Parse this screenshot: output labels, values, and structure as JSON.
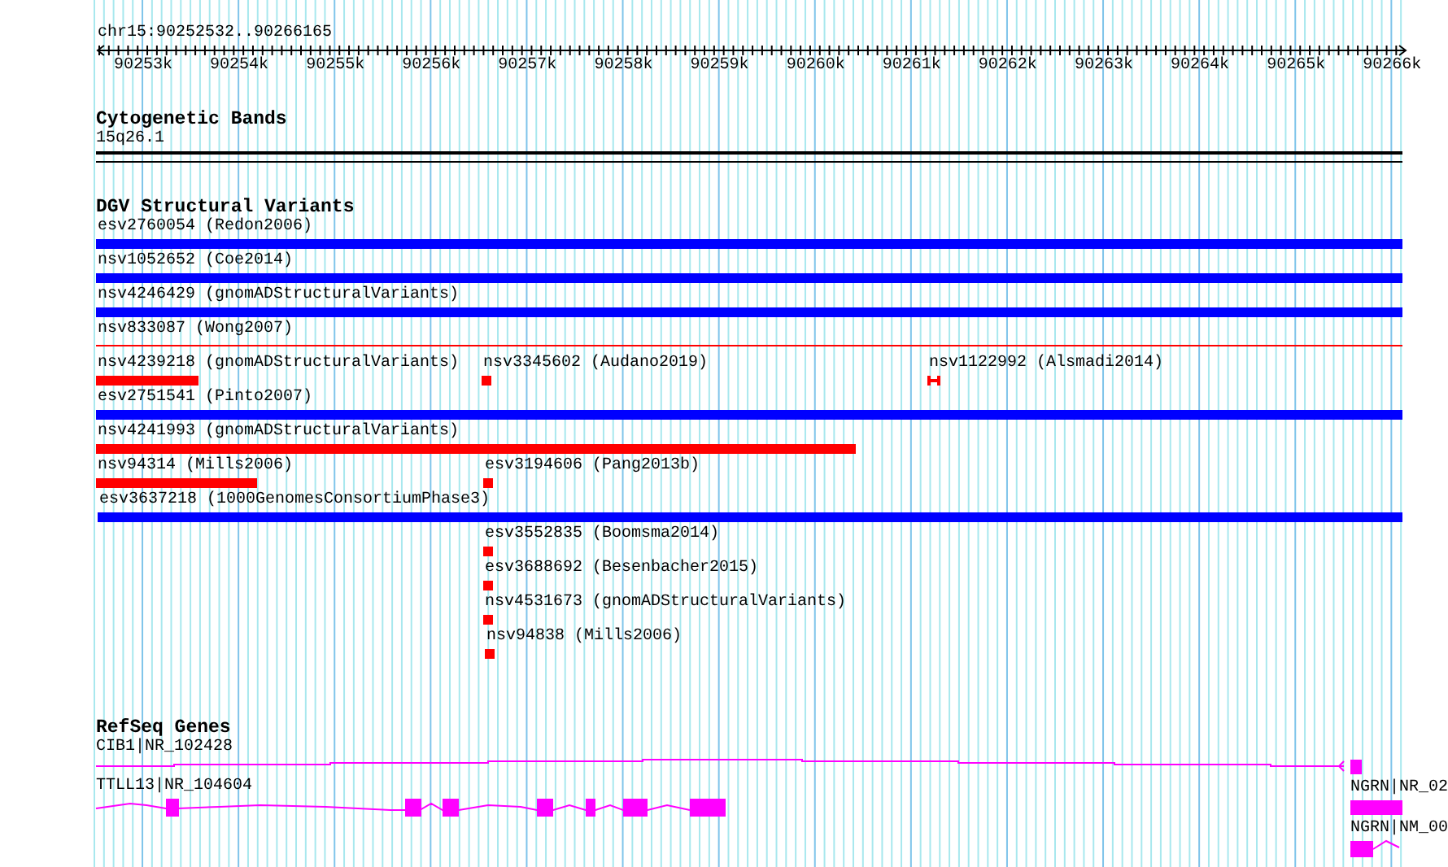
{
  "ruler": {
    "location": "chr15:90252532..90266165",
    "ticks": [
      "90253k",
      "90254k",
      "90255k",
      "90256k",
      "90257k",
      "90258k",
      "90259k",
      "90260k",
      "90261k",
      "90262k",
      "90263k",
      "90264k",
      "90265k",
      "90266k"
    ]
  },
  "cytobands": {
    "title": "Cytogenetic Bands",
    "band": "15q26.1"
  },
  "variants": {
    "title": "DGV Structural Variants",
    "features": [
      {
        "label": "esv2760054 (Redon2006)",
        "color": "#0000ff",
        "kind": "bar"
      },
      {
        "label": "nsv1052652 (Coe2014)",
        "color": "#0000ff",
        "kind": "bar"
      },
      {
        "label": "nsv4246429 (gnomADStructuralVariants)",
        "color": "#0000ff",
        "kind": "bar"
      },
      {
        "label": "nsv833087 (Wong2007)",
        "color": "#ff0000",
        "kind": "line"
      },
      {
        "label": "nsv4239218 (gnomADStructuralVariants)",
        "color": "#ff0000",
        "kind": "bar"
      },
      {
        "label": "nsv3345602 (Audano2019)",
        "color": "#ff0000",
        "kind": "bar"
      },
      {
        "label": "nsv1122992 (Alsmadi2014)",
        "color": "#ff0000",
        "kind": "marker"
      },
      {
        "label": "esv2751541 (Pinto2007)",
        "color": "#0000ff",
        "kind": "bar"
      },
      {
        "label": "nsv4241993 (gnomADStructuralVariants)",
        "color": "#ff0000",
        "kind": "bar"
      },
      {
        "label": "nsv94314 (Mills2006)",
        "color": "#ff0000",
        "kind": "bar"
      },
      {
        "label": "esv3194606 (Pang2013b)",
        "color": "#ff0000",
        "kind": "bar"
      },
      {
        "label": "esv3637218 (1000GenomesConsortiumPhase3)",
        "color": "#0000ff",
        "kind": "bar"
      },
      {
        "label": "esv3552835 (Boomsma2014)",
        "color": "#ff0000",
        "kind": "bar"
      },
      {
        "label": "esv3688692 (Besenbacher2015)",
        "color": "#ff0000",
        "kind": "bar"
      },
      {
        "label": "nsv4531673 (gnomADStructuralVariants)",
        "color": "#ff0000",
        "kind": "bar"
      },
      {
        "label": "nsv94838 (Mills2006)",
        "color": "#ff0000",
        "kind": "bar"
      }
    ]
  },
  "genes": {
    "title": "RefSeq Genes",
    "features": [
      {
        "label": "CIB1|NR_102428"
      },
      {
        "label": "TTLL13|NR_104604"
      },
      {
        "label": "NGRN|NR_02"
      },
      {
        "label": "NGRN|NM_00"
      }
    ]
  }
}
